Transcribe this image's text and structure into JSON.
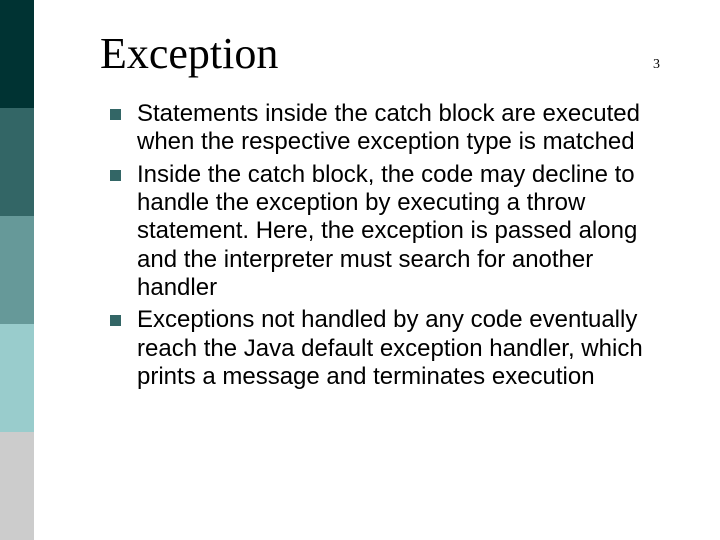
{
  "sidebar_colors": [
    "#003333",
    "#336666",
    "#669999",
    "#99CCCC",
    "#CCCCCC"
  ],
  "title": "Exception",
  "slide_number": "3",
  "bullets": [
    "Statements inside the catch block are executed when the respective exception type is matched",
    "Inside the catch block, the code may decline to handle the exception by executing a throw statement. Here, the exception is passed along and the interpreter must search for another handler",
    "Exceptions not handled by any code eventually reach the Java default exception handler, which prints a message and terminates execution"
  ]
}
